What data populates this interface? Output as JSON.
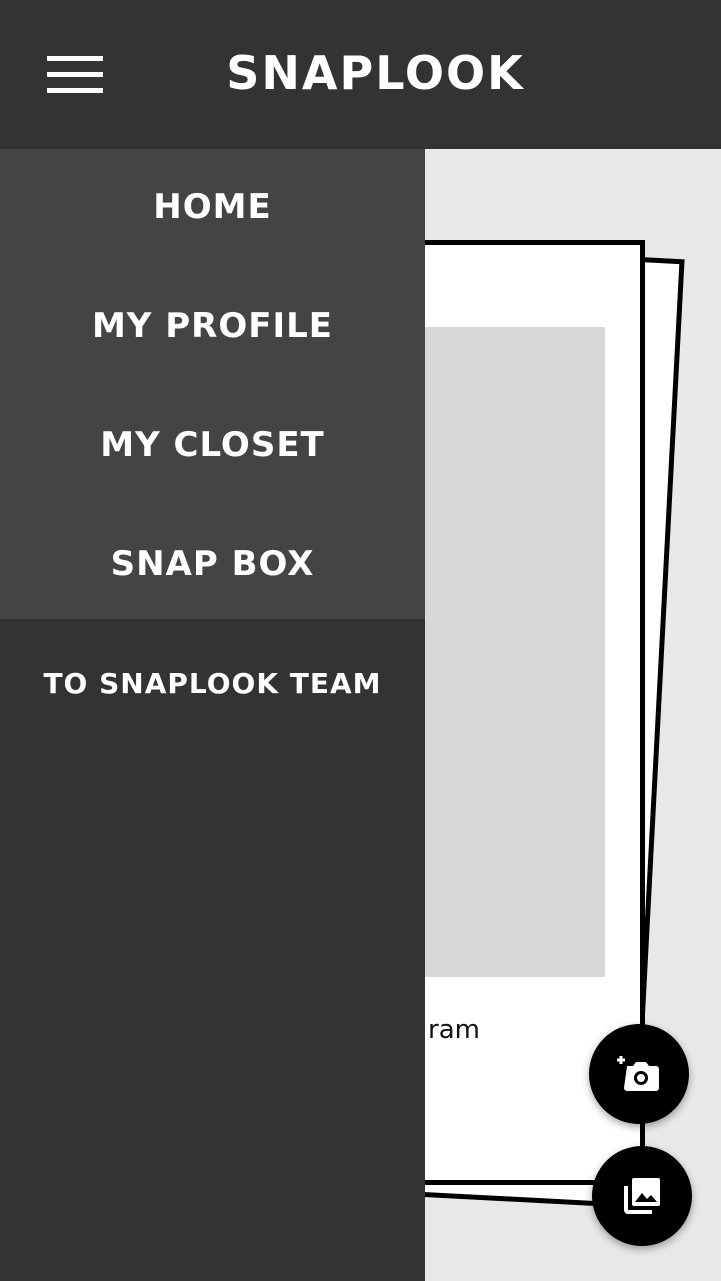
{
  "header": {
    "title": "SNAPLOOK"
  },
  "drawer": {
    "items": [
      {
        "label": "HOME"
      },
      {
        "label": "MY PROFILE"
      },
      {
        "label": "MY CLOSET"
      },
      {
        "label": "SNAP BOX"
      }
    ],
    "footer_item": {
      "label": "TO SNAPLOOK TEAM"
    }
  },
  "card": {
    "partial_text": "ram"
  },
  "icons": {
    "menu": "hamburger-menu-icon",
    "camera": "add-camera-icon",
    "gallery": "gallery-icon"
  },
  "colors": {
    "header_bg": "#333333",
    "drawer_top_bg": "#444444",
    "drawer_bg": "#333333",
    "page_bg": "#e8e8e8",
    "fab_bg": "#000000"
  }
}
